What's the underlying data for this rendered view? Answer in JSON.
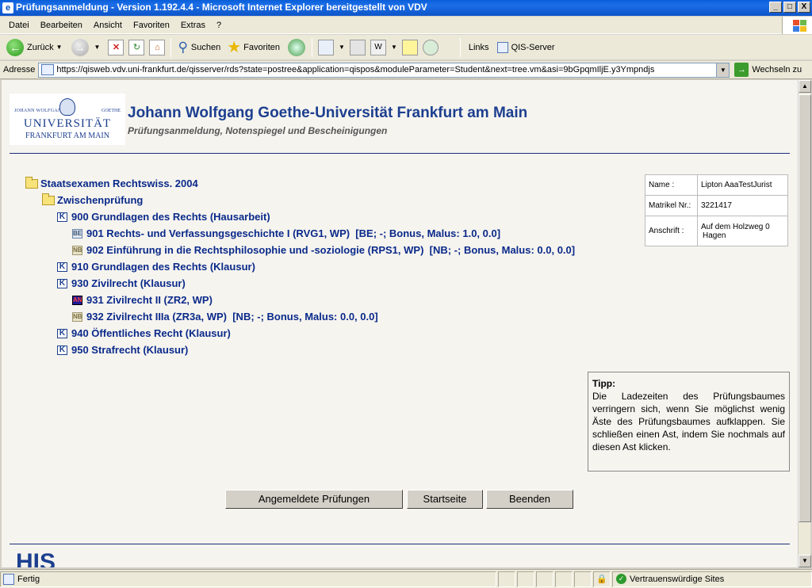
{
  "window": {
    "title": "Prüfungsanmeldung - Version 1.192.4.4 - Microsoft Internet Explorer bereitgestellt von VDV",
    "min": "_",
    "max": "□",
    "close": "X"
  },
  "menu": [
    "Datei",
    "Bearbeiten",
    "Ansicht",
    "Favoriten",
    "Extras",
    "?"
  ],
  "toolbar": {
    "back": "Zurück",
    "search": "Suchen",
    "favorites": "Favoriten",
    "links": "Links",
    "qis": "QIS-Server"
  },
  "address": {
    "label": "Adresse",
    "url": "https://qisweb.vdv.uni-frankfurt.de/qisserver/rds?state=postree&application=qispos&moduleParameter=Student&next=tree.vm&asi=9bGpqmIljE.y3Ympndjs",
    "go": "Wechseln zu"
  },
  "header": {
    "logo_line1_left": "JOHANN WOLFGANG",
    "logo_line1_right": "GOETHE",
    "logo_line2": "UNIVERSITÄT",
    "logo_line3": "FRANKFURT AM MAIN",
    "title": "Johann Wolfgang Goethe-Universität Frankfurt am Main",
    "subtitle": "Prüfungsanmeldung, Notenspiegel und Bescheinigungen"
  },
  "tree": {
    "root": "Staatsexamen Rechtswiss. 2004",
    "sub": "Zwischenprüfung",
    "items": [
      {
        "badge": "K",
        "text": "900 Grundlagen des Rechts (Hausarbeit)"
      },
      {
        "badge": "BE",
        "text": "901 Rechts- und Verfassungsgeschichte I (RVG1, WP)  [BE; -; Bonus, Malus: 1.0, 0.0]"
      },
      {
        "badge": "NB",
        "text": "902 Einführung in die Rechtsphilosophie und -soziologie (RPS1, WP)  [NB; -; Bonus, Malus: 0.0, 0.0]"
      },
      {
        "badge": "K",
        "text": "910 Grundlagen des Rechts (Klausur)"
      },
      {
        "badge": "K",
        "text": "930 Zivilrecht (Klausur)"
      },
      {
        "badge": "AN",
        "text": "931 Zivilrecht II (ZR2, WP)"
      },
      {
        "badge": "NB",
        "text": "932 Zivilrecht IIIa (ZR3a, WP)  [NB; -; Bonus, Malus: 0.0, 0.0]"
      },
      {
        "badge": "K",
        "text": "940 Öffentliches Recht (Klausur)"
      },
      {
        "badge": "K",
        "text": "950 Strafrecht (Klausur)"
      }
    ]
  },
  "student": {
    "name_label": "Name :",
    "name": "Lipton AaaTestJurist",
    "matrikel_label": "Matrikel Nr.:",
    "matrikel": "3221417",
    "address_label": "Anschrift :",
    "address_line1": "Auf dem Holzweg 0",
    "address_line2": "Hagen"
  },
  "tip": {
    "title": "Tipp:",
    "text": "Die Ladezeiten des Prüfungsbaumes verringern sich, wenn Sie möglichst wenig Äste des Prüfungsbaumes aufklappen. Sie schließen einen Ast, indem Sie nochmals auf diesen Ast klicken."
  },
  "buttons": {
    "registered": "Angemeldete Prüfungen",
    "home": "Startseite",
    "quit": "Beenden"
  },
  "footer": {
    "his": "HIS"
  },
  "status": {
    "text": "Fertig",
    "zone": "Vertrauenswürdige Sites"
  }
}
